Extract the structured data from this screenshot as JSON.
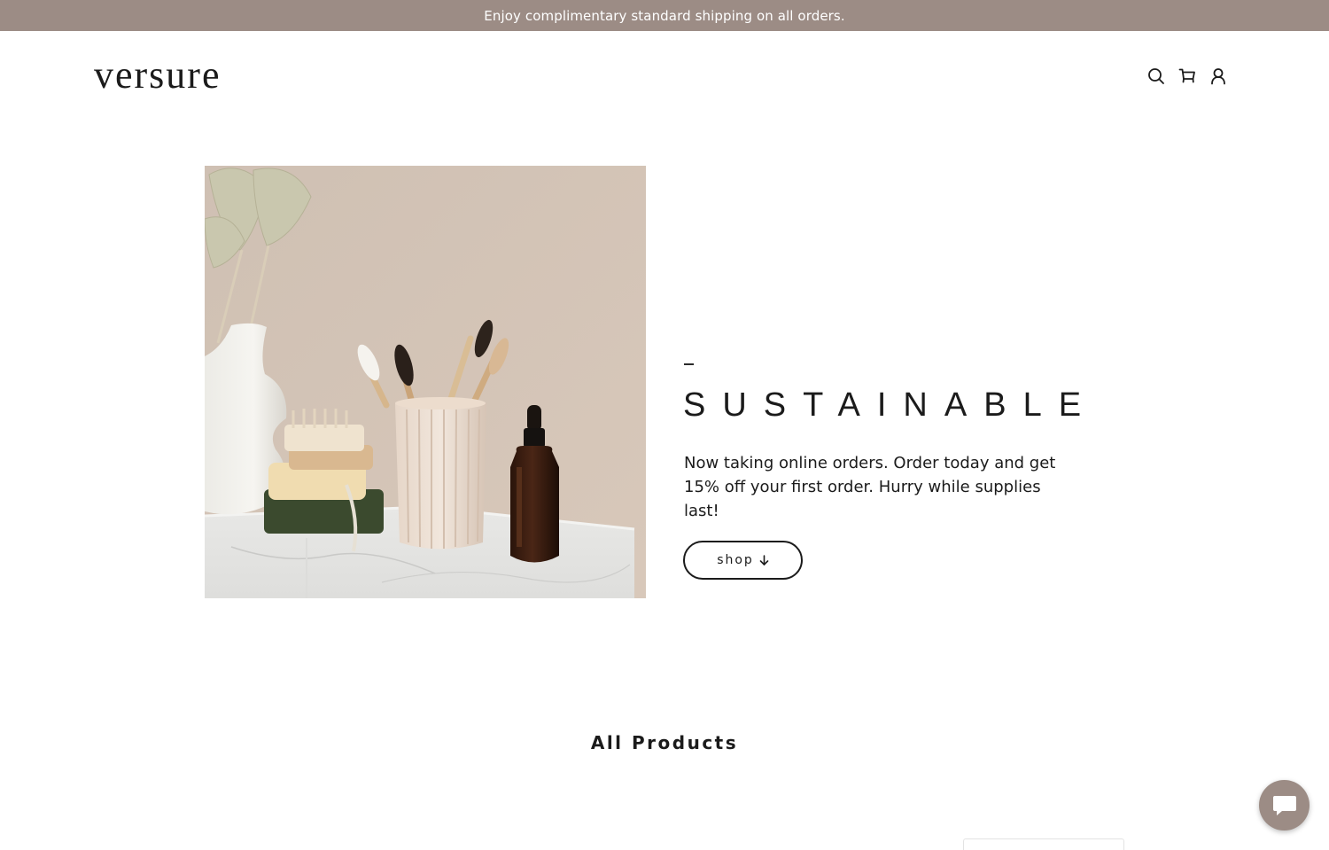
{
  "announcement": {
    "text": "Enjoy complimentary standard shipping on all orders."
  },
  "header": {
    "logo": "versure",
    "icons": [
      "search-icon",
      "cart-icon",
      "account-icon"
    ]
  },
  "hero": {
    "image_alt": "Bamboo toothbrushes in a ribbed cup beside a white vase, soap bars and an amber dropper bottle",
    "title": "SUSTAINABLE",
    "text": "Now taking online orders. Order today and get 15% off your first order. Hurry while supplies last!",
    "button_label": "shop",
    "button_icon": "arrow-down-icon"
  },
  "products": {
    "title": "All Products"
  },
  "chat": {
    "icon": "chat-bubble-icon"
  },
  "colors": {
    "announcement_bg": "#9c8c85",
    "text": "#1b1b1b",
    "background": "#ffffff",
    "chat_button": "#9c8c85"
  }
}
